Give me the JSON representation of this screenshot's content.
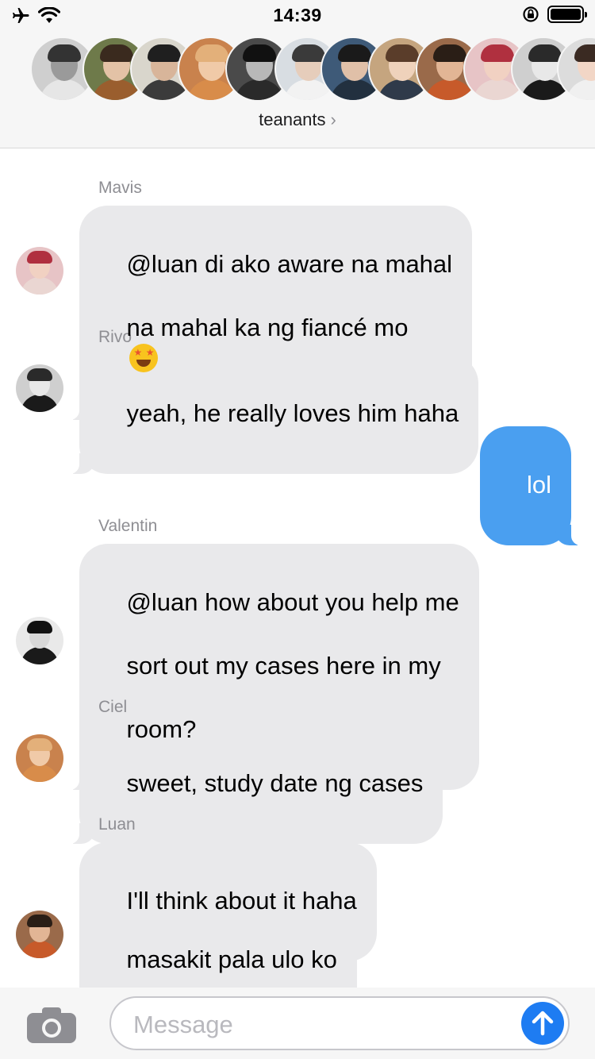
{
  "status_bar": {
    "time": "14:39",
    "airplane_icon": "airplane-icon",
    "wifi_icon": "wifi-icon",
    "rotation_lock_icon": "rotation-lock-icon",
    "battery_icon": "battery-icon"
  },
  "header": {
    "group_name": "teanants",
    "chevron": "›",
    "avatar_count": 13
  },
  "messages": [
    {
      "sender": "Mavis",
      "lines": [
        "@luan di ako aware na mahal",
        "na mahal ka ng fiancé mo"
      ],
      "emoji": "star-struck-emoji",
      "direction": "incoming"
    },
    {
      "sender": "Rivo",
      "text": "yeah, he really loves him haha",
      "direction": "incoming"
    },
    {
      "text": "lol",
      "direction": "outgoing"
    },
    {
      "sender": "Valentin",
      "lines": [
        "@luan how about you help me",
        "sort out my cases here in my",
        "room?"
      ],
      "direction": "incoming"
    },
    {
      "sender": "Ciel",
      "text": "sweet, study date ng cases",
      "direction": "incoming"
    },
    {
      "sender": "Luan",
      "text": "I'll think about it haha",
      "direction": "incoming"
    },
    {
      "text": "masakit pala ulo ko",
      "direction": "incoming"
    }
  ],
  "input_bar": {
    "placeholder": "Message",
    "camera_icon": "camera-icon",
    "send_icon": "send-arrow-icon"
  },
  "colors": {
    "incoming_bubble": "#e9e9eb",
    "outgoing_bubble": "#4a9ff0",
    "send_button": "#1e7cf2",
    "header_bg": "#f6f6f6"
  }
}
